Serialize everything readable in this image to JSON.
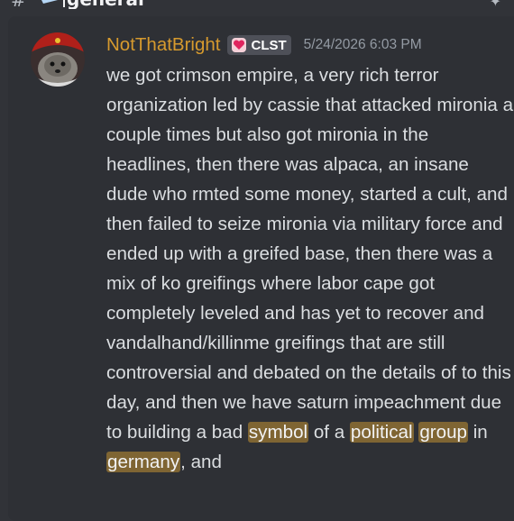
{
  "channel": {
    "hash_symbol": "#",
    "name": "general"
  },
  "message": {
    "username": "NotThatBright",
    "username_color": "#d69a2e",
    "tag": {
      "label": "CLST",
      "icon": "heart-icon"
    },
    "timestamp": "5/24/2026 6:03 PM",
    "text_before": "we got crimson empire, a very rich terror organization led by cassie that attacked mironia a couple times but also got mironia in the headlines, then there was alpaca, an insane dude who rmted some money, started a cult, and then failed to seize mironia via military force and ended up with a greifed base, then there was a mix of ko greifings where labor cape got completely leveled and has yet to recover and vandalhand/killinme greifings that are still controversial and debated on the details of to this day, and then we have saturn impeachment due to building a bad ",
    "highlight_1": "symbol",
    "text_mid_1": " of a ",
    "highlight_2": "political",
    "text_mid_2": " ",
    "highlight_3": "group",
    "text_mid_3": " in ",
    "highlight_4": "germany",
    "text_after": ", and",
    "highlight_color": "#f0b132"
  }
}
